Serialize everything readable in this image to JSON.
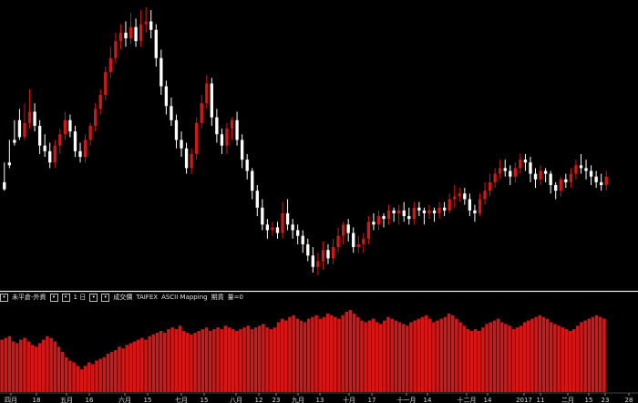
{
  "toolbar": {
    "mode_label": "未平倉-外資",
    "period_value": "1 日",
    "price_label": "成交價",
    "exchange": "TAIFEX",
    "mapping": "ASCII Mapping",
    "contract": "期貨",
    "volume_label": "量=0"
  },
  "x_axis": {
    "labels": [
      "四月",
      "18",
      "五月",
      "16",
      "六月",
      "15",
      "七月",
      "15",
      "八月",
      "12",
      "23",
      "九月",
      "13",
      "十月",
      "17",
      "十一月",
      "14",
      "十二月",
      "14",
      "2017",
      "11",
      "二月",
      "15",
      "23",
      "28"
    ]
  },
  "colors": {
    "background": "#000000",
    "up_candle": "#d41616",
    "down_candle": "#ffffff",
    "volume_bar": "#d41616",
    "divider": "#e8e8e8",
    "text": "#d8d8d8"
  },
  "chart_data": [
    {
      "type": "candlestick",
      "title": "",
      "ohlc": [
        [
          170,
          165,
          184,
          164
        ],
        [
          184,
          182,
          200,
          180
        ],
        [
          200,
          198,
          214,
          196
        ],
        [
          214,
          202,
          222,
          200
        ],
        [
          202,
          212,
          226,
          200
        ],
        [
          212,
          220,
          236,
          208
        ],
        [
          220,
          210,
          226,
          206
        ],
        [
          210,
          196,
          214,
          190
        ],
        [
          196,
          192,
          204,
          188
        ],
        [
          192,
          184,
          198,
          180
        ],
        [
          184,
          196,
          200,
          180
        ],
        [
          196,
          204,
          208,
          190
        ],
        [
          204,
          214,
          220,
          200
        ],
        [
          214,
          206,
          218,
          202
        ],
        [
          206,
          192,
          210,
          188
        ],
        [
          192,
          188,
          198,
          184
        ],
        [
          188,
          200,
          204,
          184
        ],
        [
          200,
          210,
          212,
          196
        ],
        [
          210,
          222,
          226,
          206
        ],
        [
          222,
          232,
          236,
          218
        ],
        [
          232,
          248,
          252,
          228
        ],
        [
          248,
          258,
          266,
          244
        ],
        [
          258,
          270,
          276,
          254
        ],
        [
          270,
          276,
          282,
          264
        ],
        [
          276,
          272,
          284,
          266
        ],
        [
          272,
          280,
          290,
          268
        ],
        [
          280,
          270,
          286,
          266
        ],
        [
          270,
          282,
          292,
          266
        ],
        [
          282,
          284,
          294,
          276
        ],
        [
          284,
          278,
          292,
          272
        ],
        [
          278,
          258,
          282,
          252
        ],
        [
          258,
          238,
          264,
          232
        ],
        [
          238,
          224,
          242,
          218
        ],
        [
          224,
          214,
          230,
          210
        ],
        [
          214,
          200,
          218,
          194
        ],
        [
          200,
          194,
          206,
          188
        ],
        [
          194,
          180,
          198,
          176
        ],
        [
          180,
          190,
          194,
          176
        ],
        [
          190,
          212,
          216,
          186
        ],
        [
          212,
          226,
          232,
          208
        ],
        [
          226,
          240,
          246,
          222
        ],
        [
          240,
          216,
          244,
          210
        ],
        [
          216,
          204,
          222,
          198
        ],
        [
          204,
          196,
          208,
          190
        ],
        [
          196,
          208,
          212,
          190
        ],
        [
          208,
          214,
          216,
          200
        ],
        [
          214,
          200,
          220,
          196
        ],
        [
          200,
          186,
          204,
          180
        ],
        [
          186,
          178,
          190,
          172
        ],
        [
          178,
          164,
          180,
          158
        ],
        [
          164,
          152,
          168,
          146
        ],
        [
          152,
          140,
          158,
          136
        ],
        [
          140,
          136,
          144,
          130
        ],
        [
          136,
          138,
          142,
          132
        ],
        [
          138,
          134,
          142,
          130
        ],
        [
          134,
          148,
          156,
          130
        ],
        [
          148,
          140,
          158,
          136
        ],
        [
          140,
          136,
          144,
          130
        ],
        [
          136,
          132,
          140,
          126
        ],
        [
          132,
          126,
          136,
          120
        ],
        [
          126,
          118,
          130,
          114
        ],
        [
          118,
          110,
          124,
          106
        ],
        [
          110,
          114,
          120,
          104
        ],
        [
          114,
          122,
          128,
          108
        ],
        [
          122,
          116,
          126,
          112
        ],
        [
          116,
          124,
          130,
          112
        ],
        [
          124,
          132,
          138,
          120
        ],
        [
          132,
          140,
          142,
          126
        ],
        [
          140,
          134,
          144,
          128
        ],
        [
          134,
          124,
          138,
          120
        ],
        [
          124,
          126,
          132,
          120
        ],
        [
          126,
          130,
          134,
          120
        ],
        [
          130,
          142,
          146,
          126
        ],
        [
          142,
          140,
          148,
          136
        ],
        [
          140,
          146,
          150,
          136
        ],
        [
          146,
          144,
          148,
          138
        ],
        [
          144,
          150,
          154,
          140
        ],
        [
          150,
          148,
          152,
          142
        ],
        [
          148,
          150,
          154,
          140
        ],
        [
          150,
          146,
          156,
          142
        ],
        [
          146,
          144,
          152,
          140
        ],
        [
          144,
          152,
          156,
          140
        ],
        [
          152,
          150,
          156,
          146
        ],
        [
          150,
          148,
          152,
          140
        ],
        [
          148,
          150,
          154,
          144
        ],
        [
          150,
          148,
          152,
          142
        ],
        [
          148,
          152,
          156,
          144
        ],
        [
          152,
          150,
          156,
          146
        ],
        [
          150,
          158,
          162,
          148
        ],
        [
          158,
          160,
          168,
          152
        ],
        [
          160,
          162,
          166,
          156
        ],
        [
          162,
          158,
          166,
          154
        ],
        [
          158,
          150,
          162,
          146
        ],
        [
          150,
          148,
          154,
          142
        ],
        [
          148,
          158,
          162,
          146
        ],
        [
          158,
          164,
          170,
          154
        ],
        [
          164,
          170,
          176,
          160
        ],
        [
          170,
          176,
          180,
          166
        ],
        [
          176,
          180,
          186,
          172
        ],
        [
          180,
          178,
          186,
          174
        ],
        [
          178,
          174,
          182,
          168
        ],
        [
          174,
          180,
          184,
          170
        ],
        [
          180,
          186,
          190,
          176
        ],
        [
          186,
          184,
          190,
          178
        ],
        [
          184,
          176,
          188,
          170
        ],
        [
          176,
          172,
          180,
          166
        ],
        [
          172,
          178,
          182,
          168
        ],
        [
          178,
          176,
          180,
          170
        ],
        [
          176,
          168,
          178,
          162
        ],
        [
          168,
          164,
          170,
          158
        ],
        [
          164,
          172,
          174,
          160
        ],
        [
          172,
          170,
          176,
          166
        ],
        [
          170,
          176,
          180,
          166
        ],
        [
          176,
          182,
          186,
          172
        ],
        [
          182,
          180,
          190,
          176
        ],
        [
          180,
          178,
          186,
          172
        ],
        [
          178,
          174,
          182,
          168
        ],
        [
          174,
          170,
          178,
          166
        ],
        [
          170,
          168,
          176,
          164
        ],
        [
          168,
          174,
          178,
          164
        ]
      ],
      "note_scale": "price index (axis values not printed)"
    },
    {
      "type": "bar",
      "title": "",
      "values": [
        60,
        62,
        64,
        58,
        56,
        60,
        62,
        58,
        54,
        52,
        56,
        60,
        64,
        62,
        58,
        52,
        46,
        40,
        36,
        34,
        30,
        26,
        30,
        34,
        32,
        36,
        38,
        40,
        44,
        46,
        48,
        52,
        50,
        54,
        56,
        58,
        60,
        62,
        60,
        64,
        66,
        68,
        70,
        68,
        72,
        74,
        72,
        76,
        70,
        68,
        66,
        68,
        70,
        72,
        74,
        70,
        72,
        74,
        72,
        76,
        74,
        72,
        70,
        72,
        74,
        76,
        72,
        74,
        76,
        78,
        74,
        72,
        74,
        80,
        84,
        82,
        86,
        88,
        84,
        82,
        80,
        84,
        86,
        88,
        84,
        86,
        90,
        88,
        86,
        84,
        88,
        92,
        94,
        90,
        86,
        82,
        80,
        82,
        84,
        80,
        78,
        82,
        86,
        84,
        82,
        80,
        78,
        76,
        80,
        82,
        84,
        86,
        88,
        84,
        80,
        82,
        84,
        86,
        90,
        88,
        84,
        80,
        76,
        72,
        70,
        72,
        70,
        74,
        78,
        80,
        82,
        84,
        80,
        78,
        76,
        72,
        74,
        76,
        80,
        82,
        84,
        86,
        88,
        86,
        84,
        80,
        78,
        76,
        74,
        72,
        70,
        72,
        76,
        80,
        82,
        84,
        86,
        88,
        86,
        84
      ]
    }
  ]
}
